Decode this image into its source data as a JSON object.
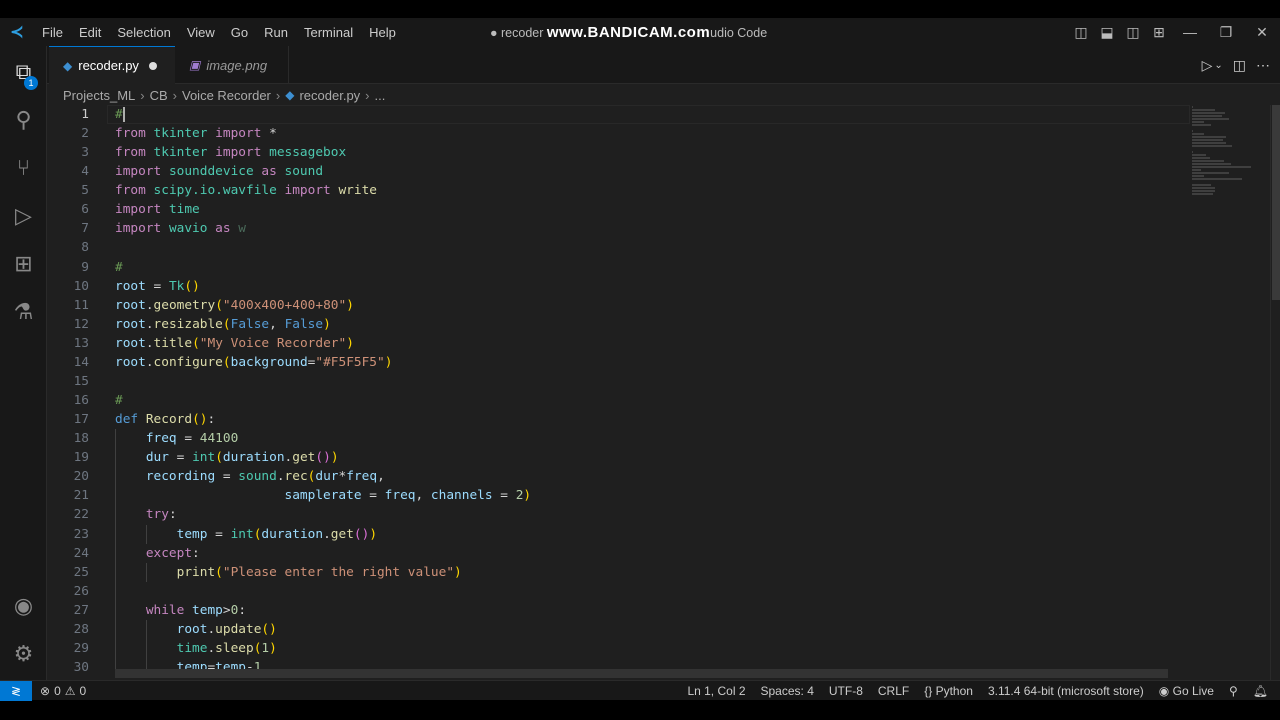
{
  "titlebar": {
    "menu": [
      "File",
      "Edit",
      "Selection",
      "View",
      "Go",
      "Run",
      "Terminal",
      "Help"
    ],
    "title_prefix": "● recoder",
    "watermark": "www.BANDICAM.com",
    "title_suffix": "udio Code"
  },
  "activity": {
    "explorer_badge": "1"
  },
  "tabs": [
    {
      "label": "recoder.py",
      "modified": true
    },
    {
      "label": "image.png"
    }
  ],
  "breadcrumb": [
    "Projects_ML",
    "CB",
    "Voice Recorder",
    "recoder.py",
    "..."
  ],
  "editor": {
    "current_line": 1,
    "lines": [
      [
        [
          "#",
          "cm"
        ]
      ],
      [
        [
          "from ",
          "kw"
        ],
        [
          "tkinter ",
          "mod"
        ],
        [
          "import ",
          "kw"
        ],
        [
          "*",
          "p"
        ]
      ],
      [
        [
          "from ",
          "kw"
        ],
        [
          "tkinter ",
          "mod"
        ],
        [
          "import ",
          "kw"
        ],
        [
          "messagebox",
          "mod"
        ]
      ],
      [
        [
          "import ",
          "kw"
        ],
        [
          "sounddevice ",
          "mod"
        ],
        [
          "as ",
          "kw"
        ],
        [
          "sound",
          "mod"
        ]
      ],
      [
        [
          "from ",
          "kw"
        ],
        [
          "scipy.io.wavfile ",
          "mod"
        ],
        [
          "import ",
          "kw"
        ],
        [
          "write",
          "fn"
        ]
      ],
      [
        [
          "import ",
          "kw"
        ],
        [
          "time",
          "mod"
        ]
      ],
      [
        [
          "import ",
          "kw"
        ],
        [
          "wavio ",
          "mod"
        ],
        [
          "as ",
          "kw"
        ],
        [
          "w",
          "dim"
        ]
      ],
      [],
      [
        [
          "#",
          "cm"
        ]
      ],
      [
        [
          "root",
          "var"
        ],
        [
          " = ",
          "p"
        ],
        [
          "Tk",
          "mod"
        ],
        [
          "()",
          "br1"
        ]
      ],
      [
        [
          "root",
          "var"
        ],
        [
          ".",
          "p"
        ],
        [
          "geometry",
          "fn"
        ],
        [
          "(",
          "br1"
        ],
        [
          "\"400x400+400+80\"",
          "str"
        ],
        [
          ")",
          "br1"
        ]
      ],
      [
        [
          "root",
          "var"
        ],
        [
          ".",
          "p"
        ],
        [
          "resizable",
          "fn"
        ],
        [
          "(",
          "br1"
        ],
        [
          "False",
          "bl"
        ],
        [
          ", ",
          "p"
        ],
        [
          "False",
          "bl"
        ],
        [
          ")",
          "br1"
        ]
      ],
      [
        [
          "root",
          "var"
        ],
        [
          ".",
          "p"
        ],
        [
          "title",
          "fn"
        ],
        [
          "(",
          "br1"
        ],
        [
          "\"My Voice Recorder\"",
          "str"
        ],
        [
          ")",
          "br1"
        ]
      ],
      [
        [
          "root",
          "var"
        ],
        [
          ".",
          "p"
        ],
        [
          "configure",
          "fn"
        ],
        [
          "(",
          "br1"
        ],
        [
          "background",
          "var"
        ],
        [
          "=",
          "p"
        ],
        [
          "\"#F5F5F5\"",
          "str"
        ],
        [
          ")",
          "br1"
        ]
      ],
      [],
      [
        [
          "#",
          "cm"
        ]
      ],
      [
        [
          "def ",
          "bl"
        ],
        [
          "Record",
          "fn"
        ],
        [
          "()",
          "br1"
        ],
        [
          ":",
          "p"
        ]
      ],
      [
        [
          "    freq",
          "var"
        ],
        [
          " = ",
          "p"
        ],
        [
          "44100",
          "num"
        ]
      ],
      [
        [
          "    dur",
          "var"
        ],
        [
          " = ",
          "p"
        ],
        [
          "int",
          "mod"
        ],
        [
          "(",
          "br1"
        ],
        [
          "duration",
          "var"
        ],
        [
          ".",
          "p"
        ],
        [
          "get",
          "fn"
        ],
        [
          "()",
          "br2"
        ],
        [
          ")",
          "br1"
        ]
      ],
      [
        [
          "    recording",
          "var"
        ],
        [
          " = ",
          "p"
        ],
        [
          "sound",
          "mod"
        ],
        [
          ".",
          "p"
        ],
        [
          "rec",
          "fn"
        ],
        [
          "(",
          "br1"
        ],
        [
          "dur",
          "var"
        ],
        [
          "*",
          "p"
        ],
        [
          "freq",
          "var"
        ],
        [
          ",",
          "p"
        ]
      ],
      [
        [
          "                      samplerate",
          "var"
        ],
        [
          " = ",
          "p"
        ],
        [
          "freq",
          "var"
        ],
        [
          ", ",
          "p"
        ],
        [
          "channels",
          "var"
        ],
        [
          " = ",
          "p"
        ],
        [
          "2",
          "num"
        ],
        [
          ")",
          "br1"
        ]
      ],
      [
        [
          "    try",
          "kw"
        ],
        [
          ":",
          "p"
        ]
      ],
      [
        [
          "        temp",
          "var"
        ],
        [
          " = ",
          "p"
        ],
        [
          "int",
          "mod"
        ],
        [
          "(",
          "br1"
        ],
        [
          "duration",
          "var"
        ],
        [
          ".",
          "p"
        ],
        [
          "get",
          "fn"
        ],
        [
          "()",
          "br2"
        ],
        [
          ")",
          "br1"
        ]
      ],
      [
        [
          "    except",
          "kw"
        ],
        [
          ":",
          "p"
        ]
      ],
      [
        [
          "        print",
          "fn"
        ],
        [
          "(",
          "br1"
        ],
        [
          "\"Please enter the right value\"",
          "str"
        ],
        [
          ")",
          "br1"
        ]
      ],
      [],
      [
        [
          "    while ",
          "kw"
        ],
        [
          "temp",
          "var"
        ],
        [
          ">",
          "p"
        ],
        [
          "0",
          "num"
        ],
        [
          ":",
          "p"
        ]
      ],
      [
        [
          "        root",
          "var"
        ],
        [
          ".",
          "p"
        ],
        [
          "update",
          "fn"
        ],
        [
          "()",
          "br1"
        ]
      ],
      [
        [
          "        time",
          "mod"
        ],
        [
          ".",
          "p"
        ],
        [
          "sleep",
          "fn"
        ],
        [
          "(",
          "br1"
        ],
        [
          "1",
          "num"
        ],
        [
          ")",
          "br1"
        ]
      ],
      [
        [
          "        temp",
          "var"
        ],
        [
          "=",
          "p"
        ],
        [
          "temp",
          "var"
        ],
        [
          "-",
          "p"
        ],
        [
          "1",
          "num"
        ]
      ]
    ]
  },
  "status": {
    "errors": "0",
    "warnings": "0",
    "position": "Ln 1, Col 2",
    "spaces": "Spaces: 4",
    "encoding": "UTF-8",
    "eol": "CRLF",
    "language": "Python",
    "interpreter": "3.11.4 64-bit (microsoft store)",
    "golive": "Go Live"
  }
}
